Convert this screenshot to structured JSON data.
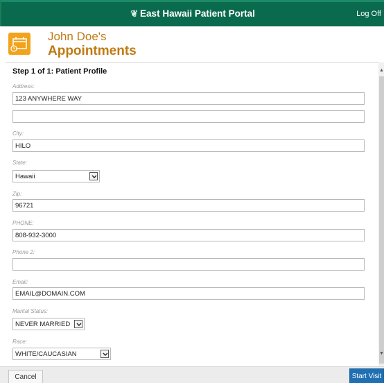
{
  "topbar": {
    "title": "East Hawaii Patient Portal",
    "logoff": "Log Off",
    "logo_icon": "plant-logo-icon",
    "bg_color": "#0a6a4d"
  },
  "header": {
    "name": "John Doe's",
    "section": "Appointments",
    "icon": "calendar-icon",
    "accent_color": "#c07a12"
  },
  "form": {
    "step": "Step 1 of 1: Patient Profile",
    "address_label": "Address:",
    "address1": "123 ANYWHERE WAY",
    "address2": "",
    "city_label": "City:",
    "city": "HILO",
    "state_label": "State:",
    "state": "Hawaii",
    "zip_label": "Zip:",
    "zip": "96721",
    "phone_label": "PHONE:",
    "phone": "808-932-3000",
    "phone2_label": "Phone 2:",
    "phone2": "",
    "email_label": "Email:",
    "email": "EMAIL@DOMAIN.COM",
    "marital_label": "Marital Status:",
    "marital": "NEVER MARRIED",
    "race_label": "Race:",
    "race": "WHITE/CAUCASIAN"
  },
  "footer": {
    "cancel": "Cancel",
    "start": "Start Visit",
    "start_color": "#1f6fb2"
  }
}
